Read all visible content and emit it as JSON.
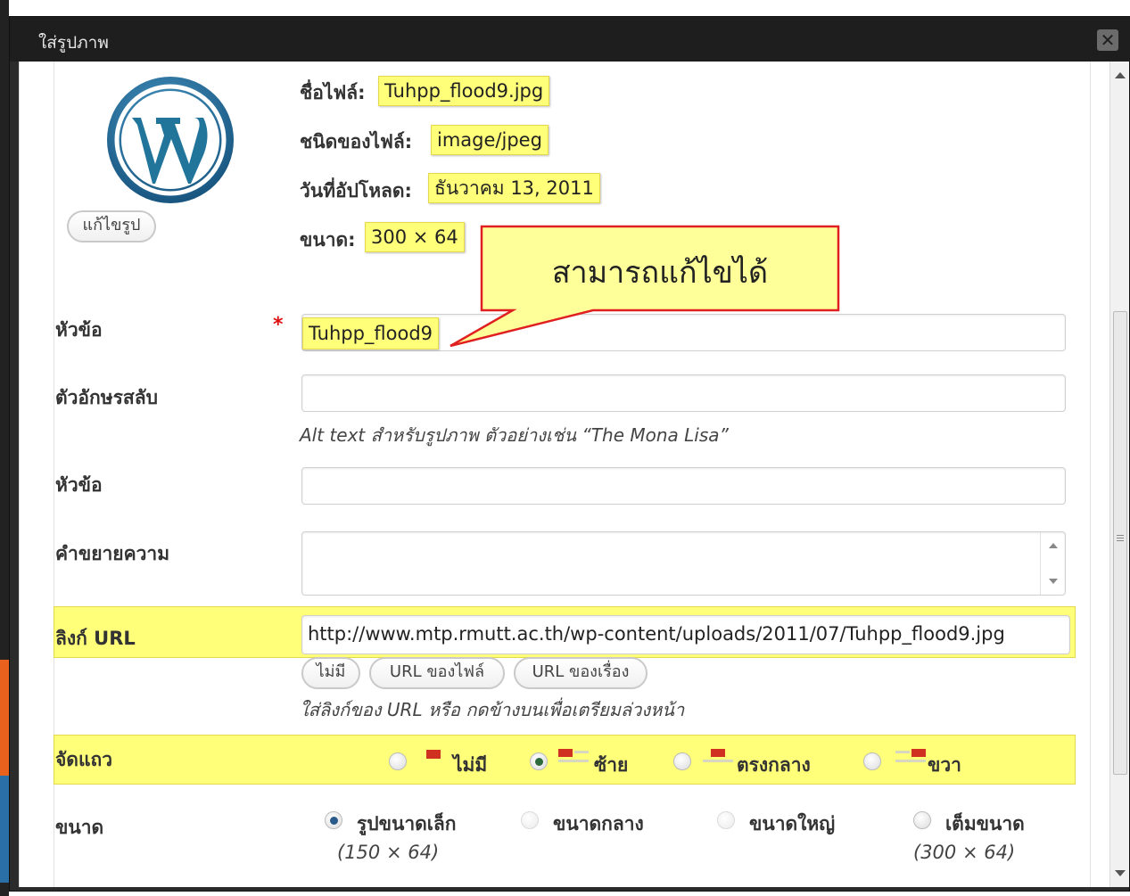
{
  "dialog": {
    "title": "ใส่รูปภาพ",
    "close_glyph": "✕"
  },
  "file_meta": {
    "filename_label": "ชื่อไฟล์:",
    "filename_value": "Tuhpp_flood9.jpg",
    "filetype_label": "ชนิดของไฟล์:",
    "filetype_value": "image/jpeg",
    "upload_date_label": "วันที่อัปโหลด:",
    "upload_date_value": "ธันวาคม 13, 2011",
    "dimensions_label": "ขนาด:",
    "dimensions_value": "300 × 64",
    "edit_image_button": "แก้ไขรูป"
  },
  "callout": {
    "text": "สามารถแก้ไขได้"
  },
  "form": {
    "title_label": "หัวข้อ",
    "title_required": "*",
    "title_value": "Tuhpp_flood9",
    "alt_label": "ตัวอักษรสลับ",
    "alt_value": "",
    "alt_hint": "Alt text สำหรับรูปภาพ ตัวอย่างเช่น “The Mona Lisa”",
    "caption_label": "หัวข้อ",
    "caption_value": "",
    "description_label": "คำขยายความ",
    "description_value": "",
    "link_label": "ลิงก์ URL",
    "link_value": "http://www.mtp.rmutt.ac.th/wp-content/uploads/2011/07/Tuhpp_flood9.jpg",
    "link_buttons": [
      "ไม่มี",
      "URL ของไฟล์",
      "URL ของเรื่อง"
    ],
    "link_hint": "ใส่ลิงก์ของ URL หรือ กดข้างบนเพื่อเตรียมล่วงหน้า",
    "align_label": "จัดแถว",
    "align_options": [
      {
        "label": "ไม่มี",
        "checked": false
      },
      {
        "label": "ซ้าย",
        "checked": true
      },
      {
        "label": "ตรงกลาง",
        "checked": false
      },
      {
        "label": "ขวา",
        "checked": false
      }
    ],
    "size_label": "ขนาด",
    "size_options": [
      {
        "label": "รูปขนาดเล็ก",
        "dim": "(150 × 64)",
        "checked": true,
        "enabled": true
      },
      {
        "label": "ขนาดกลาง",
        "dim": "",
        "checked": false,
        "enabled": false
      },
      {
        "label": "ขนาดใหญ่",
        "dim": "",
        "checked": false,
        "enabled": false
      },
      {
        "label": "เต็มขนาด",
        "dim": "(300 × 64)",
        "checked": false,
        "enabled": true
      }
    ]
  },
  "colors": {
    "highlight": "#ffff7a",
    "titlebar": "#1e1e1e",
    "callout_border": "#e02020",
    "callout_fill": "#ffff9a",
    "wp_blue": "#21759b"
  },
  "icons": {
    "logo": "wordpress-logo-icon",
    "close": "close-icon"
  }
}
